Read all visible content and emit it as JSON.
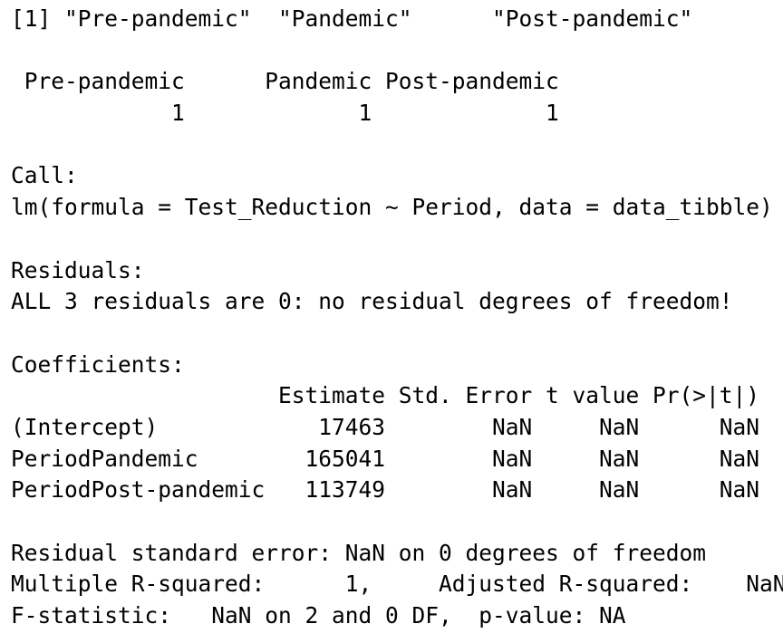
{
  "console": {
    "lines": [
      "[1] \"Pre-pandemic\"  \"Pandemic\"      \"Post-pandemic\"",
      "",
      " Pre-pandemic      Pandemic Post-pandemic",
      "            1             1             1",
      "",
      "Call:",
      "lm(formula = Test_Reduction ~ Period, data = data_tibble)",
      "",
      "Residuals:",
      "ALL 3 residuals are 0: no residual degrees of freedom!",
      "",
      "Coefficients:",
      "                    Estimate Std. Error t value Pr(>|t|)",
      "(Intercept)            17463        NaN     NaN      NaN",
      "PeriodPandemic        165041        NaN     NaN      NaN",
      "PeriodPost-pandemic   113749        NaN     NaN      NaN",
      "",
      "Residual standard error: NaN on 0 degrees of freedom",
      "Multiple R-squared:      1,     Adjusted R-squared:    NaN",
      "F-statistic:   NaN on 2 and 0 DF,  p-value: NA"
    ]
  }
}
